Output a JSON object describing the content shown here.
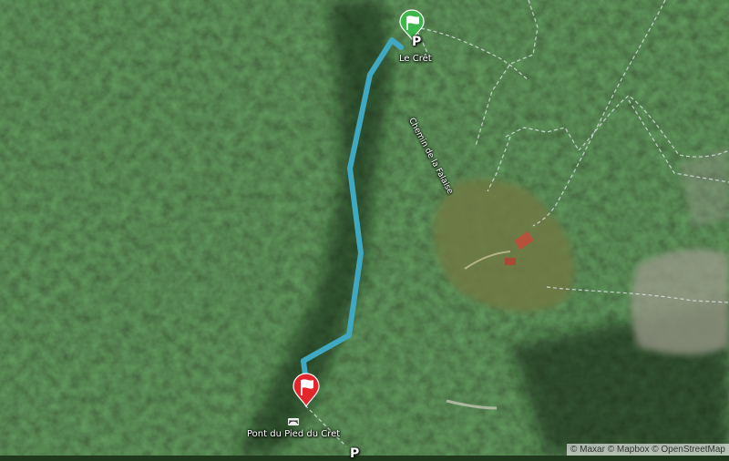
{
  "map": {
    "imagery": "satellite",
    "route_color": "#3fa9c4",
    "start_marker_color": "#3cb54a",
    "end_marker_color": "#e3262b"
  },
  "labels": {
    "start_place": "Le Crêt",
    "road": "Chemin de la Falaise",
    "end_place": "Pont du Pied du Cret",
    "parking_top": "P",
    "parking_bottom": "P"
  },
  "attribution": [
    "© Maxar",
    "© Mapbox",
    "© OpenStreetMap"
  ]
}
